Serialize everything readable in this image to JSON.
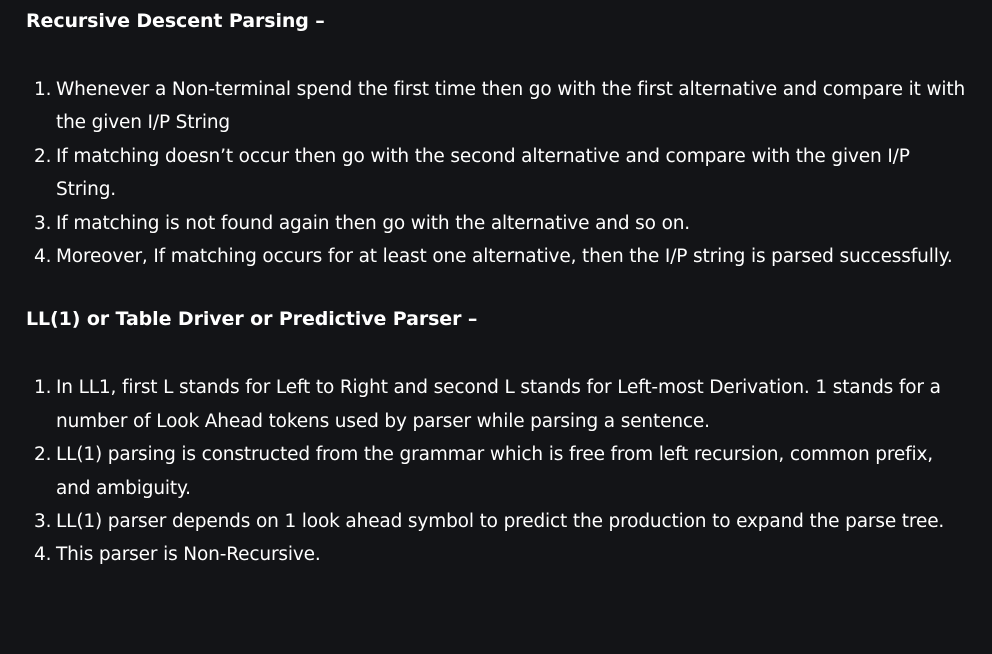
{
  "sections": [
    {
      "heading": "Recursive Descent Parsing –",
      "items": [
        {
          "num": "1.",
          "text": "Whenever a Non-terminal spend the first time then go with the first alternative and compare it with the given I/P String"
        },
        {
          "num": "2.",
          "text": "If matching doesn’t occur then go with the second alternative and compare with the given I/P String."
        },
        {
          "num": "3.",
          "text": "If matching is not found again then go with the alternative and so on."
        },
        {
          "num": "4.",
          "text": "Moreover, If matching occurs for at least one alternative, then the I/P string is parsed successfully."
        }
      ]
    },
    {
      "heading": "LL(1) or Table Driver or Predictive Parser –",
      "items": [
        {
          "num": "1.",
          "text": "In LL1, first L stands for Left to Right and second L stands for Left-most Derivation. 1 stands for a number of Look Ahead tokens used by parser while parsing a sentence."
        },
        {
          "num": "2.",
          "text": "LL(1) parsing is constructed from the grammar which is free from left recursion, common prefix, and ambiguity."
        },
        {
          "num": "3.",
          "text": "LL(1) parser depends on 1 look ahead symbol to predict the production to expand the parse tree."
        },
        {
          "num": "4.",
          "text": "This parser is Non-Recursive."
        }
      ]
    }
  ]
}
